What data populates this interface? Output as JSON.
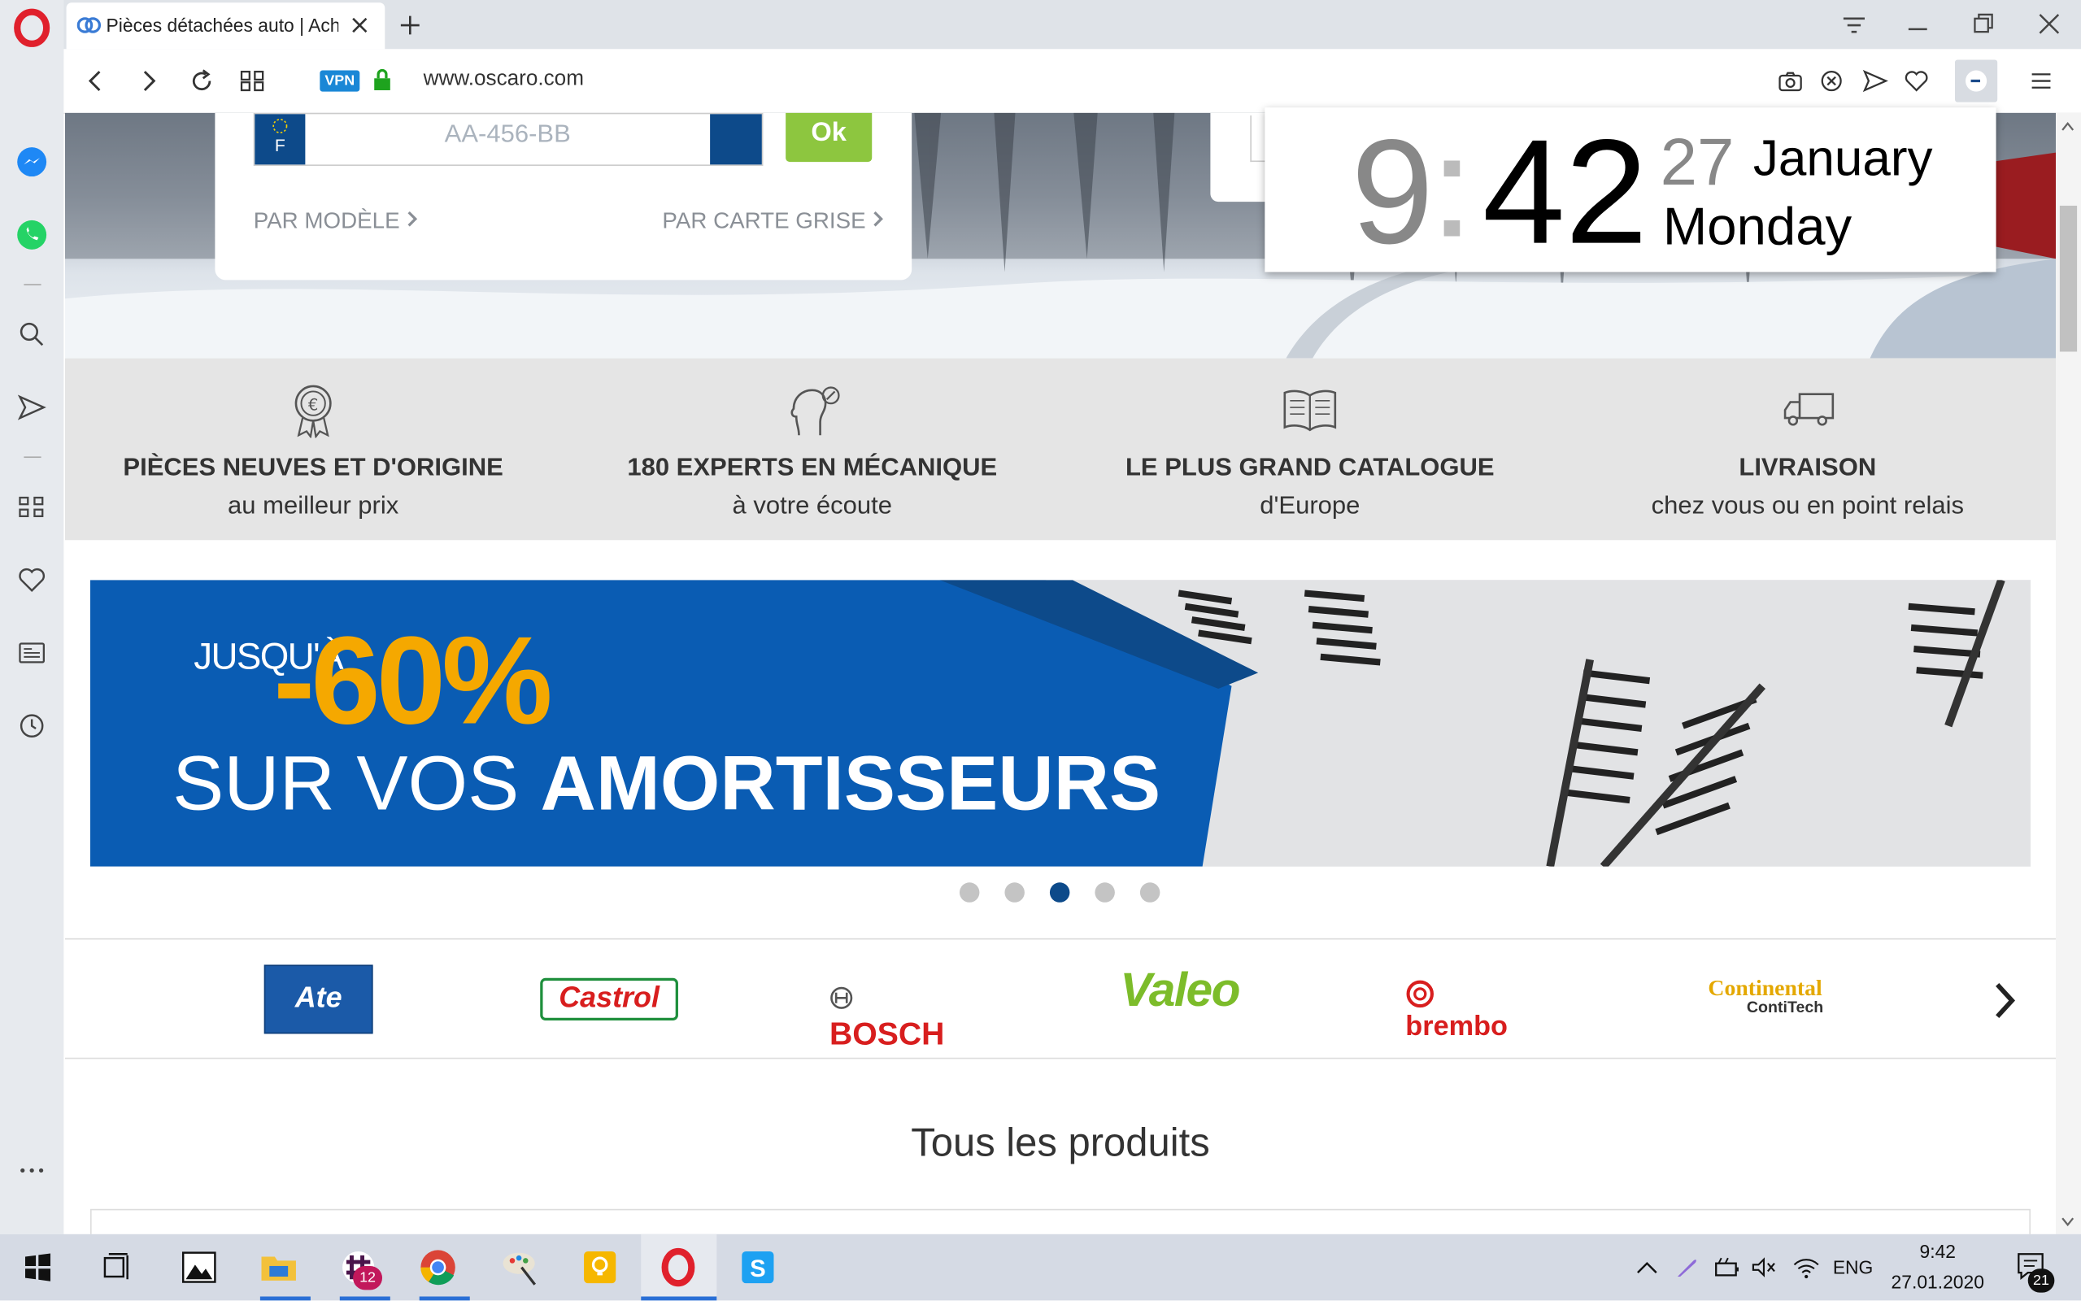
{
  "browser": {
    "tab_title": "Pièces détachées auto | Ach",
    "url": "www.oscaro.com",
    "vpn_label": "VPN"
  },
  "hero": {
    "plate_placeholder": "AA-456-BB",
    "plate_country": "F",
    "ok_label": "Ok",
    "by_model": "PAR MODÈLE",
    "by_card": "PAR CARTE GRISE"
  },
  "clock": {
    "hour": "9",
    "minute": "42",
    "day": "27",
    "month": "January",
    "weekday": "Monday"
  },
  "features": [
    {
      "title": "PIÈCES NEUVES ET D'ORIGINE",
      "sub": "au meilleur prix",
      "icon": "medal-euro-icon"
    },
    {
      "title": "180 EXPERTS EN MÉCANIQUE",
      "sub": "à votre écoute",
      "icon": "expert-head-icon"
    },
    {
      "title": "LE PLUS GRAND CATALOGUE",
      "sub": "d'Europe",
      "icon": "open-book-icon"
    },
    {
      "title": "LIVRAISON",
      "sub": "chez vous ou en point relais",
      "icon": "truck-icon"
    }
  ],
  "banner": {
    "upto": "JUSQU'À",
    "percent": "-60%",
    "line_pre": "SUR VOS ",
    "line_bold": "AMORTISSEURS",
    "dots": 5,
    "active_dot": 3
  },
  "brands": [
    "Ate",
    "Castrol",
    "BOSCH",
    "Valeo",
    "brembo",
    "Continental",
    "ContiTech"
  ],
  "products_heading": "Tous les produits",
  "taskbar": {
    "slack_badge": "12",
    "lang": "ENG",
    "time": "9:42",
    "date": "27.01.2020",
    "notif_count": "21"
  },
  "colors": {
    "oscaro_blue": "#0d4a8a",
    "ok_green": "#8dc63f",
    "promo_orange": "#f5a800",
    "banner_blue": "#0a5cb3"
  }
}
